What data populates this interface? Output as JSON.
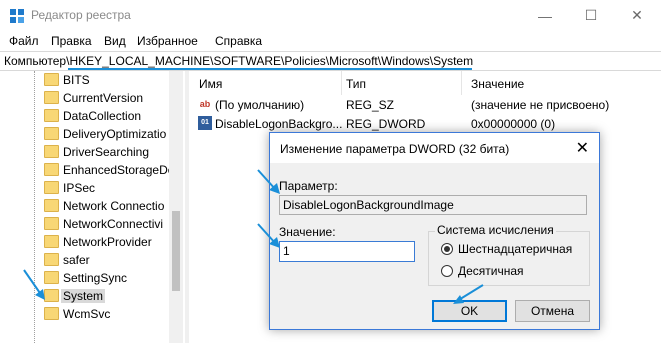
{
  "window": {
    "title": "Редактор реестра",
    "minimize_glyph": "—",
    "maximize_glyph": "☐",
    "close_glyph": "✕"
  },
  "menu": [
    "Файл",
    "Правка",
    "Вид",
    "Избранное",
    "Справка"
  ],
  "address": {
    "prefix": "Компьютер\\",
    "path": "HKEY_LOCAL_MACHINE\\SOFTWARE\\Policies\\Microsoft\\Windows\\System"
  },
  "tree": {
    "items": [
      "BITS",
      "CurrentVersion",
      "DataCollection",
      "DeliveryOptimizatio",
      "DriverSearching",
      "EnhancedStorageDe",
      "IPSec",
      "Network Connectio",
      "NetworkConnectivi",
      "NetworkProvider",
      "safer",
      "SettingSync",
      "System",
      "WcmSvc"
    ],
    "selected": "System"
  },
  "list": {
    "headers": {
      "name": "Имя",
      "type": "Тип",
      "value": "Значение"
    },
    "rows": [
      {
        "icon": "ab",
        "name": "(По умолчанию)",
        "type": "REG_SZ",
        "value": "(значение не присвоено)"
      },
      {
        "icon": "dword",
        "name": "DisableLogonBackgro...",
        "type": "REG_DWORD",
        "value": "0x00000000 (0)"
      }
    ]
  },
  "dialog": {
    "title": "Изменение параметра DWORD (32 бита)",
    "param_label": "Параметр:",
    "param_value": "DisableLogonBackgroundImage",
    "value_label": "Значение:",
    "value_input": "1",
    "base_label": "Система исчисления",
    "radio_hex": "Шестнадцатеричная",
    "radio_dec": "Десятичная",
    "ok": "OK",
    "cancel": "Отмена",
    "close_glyph": "✕",
    "selected_base": "hex"
  },
  "accent_color": "#1a8fd8",
  "folder_color": "#f8d775"
}
